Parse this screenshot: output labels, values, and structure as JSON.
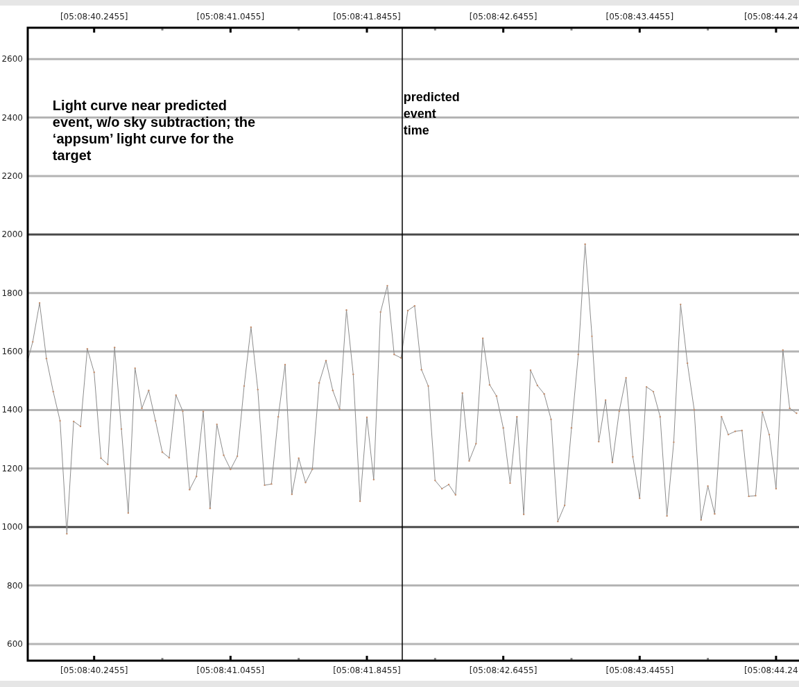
{
  "plot": {
    "top_axis": {
      "tick_labels": [
        "[05:08:40.2455]",
        "[05:08:41.0455]",
        "[05:08:41.8455]",
        "[05:08:42.6455]",
        "[05:08:43.4455]",
        "[05:08:44.24"
      ]
    },
    "chart_data": {
      "type": "line",
      "categories": [
        null,
        null,
        null,
        null,
        null,
        null,
        null,
        null,
        null,
        null,
        "[05:08:40.2455]",
        null,
        null,
        null,
        null,
        null,
        null,
        null,
        null,
        null,
        null,
        null,
        null,
        null,
        null,
        null,
        null,
        null,
        null,
        null,
        "[05:08:41.0455]",
        null,
        null,
        null,
        null,
        null,
        null,
        null,
        null,
        null,
        null,
        null,
        null,
        null,
        null,
        null,
        null,
        null,
        null,
        null,
        "[05:08:41.8455]",
        null,
        null,
        null,
        null,
        null,
        null,
        null,
        null,
        null,
        null,
        null,
        null,
        null,
        null,
        null,
        null,
        null,
        null,
        null,
        "[05:08:42.6455]",
        null,
        null,
        null,
        null,
        null,
        null,
        null,
        null,
        null,
        null,
        null,
        null,
        null,
        null,
        null,
        null,
        null,
        null,
        null,
        "[05:08:43.4455]",
        null,
        null,
        null,
        null,
        null,
        null,
        null,
        null,
        null,
        null,
        null,
        null,
        null,
        null,
        null,
        null,
        null,
        null,
        null,
        "[05:08:44.24",
        null,
        null,
        null
      ],
      "series": [
        {
          "color": "#8c8c8c",
          "values": [
            1569,
            1633,
            1766,
            1576,
            1463,
            1363,
            977,
            1361,
            1344,
            1609,
            1529,
            1235,
            1214,
            1614,
            1335,
            1048,
            1543,
            1406,
            1467,
            1363,
            1256,
            1237,
            1451,
            1396,
            1128,
            1173,
            1395,
            1064,
            1351,
            1245,
            1197,
            1242,
            1482,
            1683,
            1470,
            1143,
            1147,
            1377,
            1555,
            1112,
            1235,
            1152,
            1197,
            1493,
            1569,
            1467,
            1403,
            1742,
            1522,
            1088,
            1375,
            1162,
            1735,
            1825,
            1590,
            1578,
            1740,
            1756,
            1538,
            1482,
            1159,
            1131,
            1145,
            1110,
            1458,
            1226,
            1285,
            1645,
            1486,
            1448,
            1339,
            1150,
            1377,
            1043,
            1536,
            1484,
            1455,
            1368,
            1019,
            1074,
            1339,
            1590,
            1967,
            1652,
            1292,
            1434,
            1221,
            1396,
            1510,
            1240,
            1098,
            1479,
            1463,
            1377,
            1038,
            1290,
            1761,
            1560,
            1401,
            1024,
            1140,
            1045,
            1377,
            1316,
            1327,
            1330,
            1105,
            1107,
            1392,
            1316,
            1131,
            1605,
            1406,
            1389
          ]
        }
      ],
      "ylim": [
        543,
        2707
      ],
      "grid": true,
      "yticks": [
        600,
        800,
        1000,
        1200,
        1400,
        1600,
        1800,
        2000,
        2200,
        2400,
        2600
      ],
      "annotations": [
        "Light curve near predicted event, w/o sky subtraction; the ‘appsum’ light curve for the target",
        "predicted event time"
      ]
    }
  }
}
